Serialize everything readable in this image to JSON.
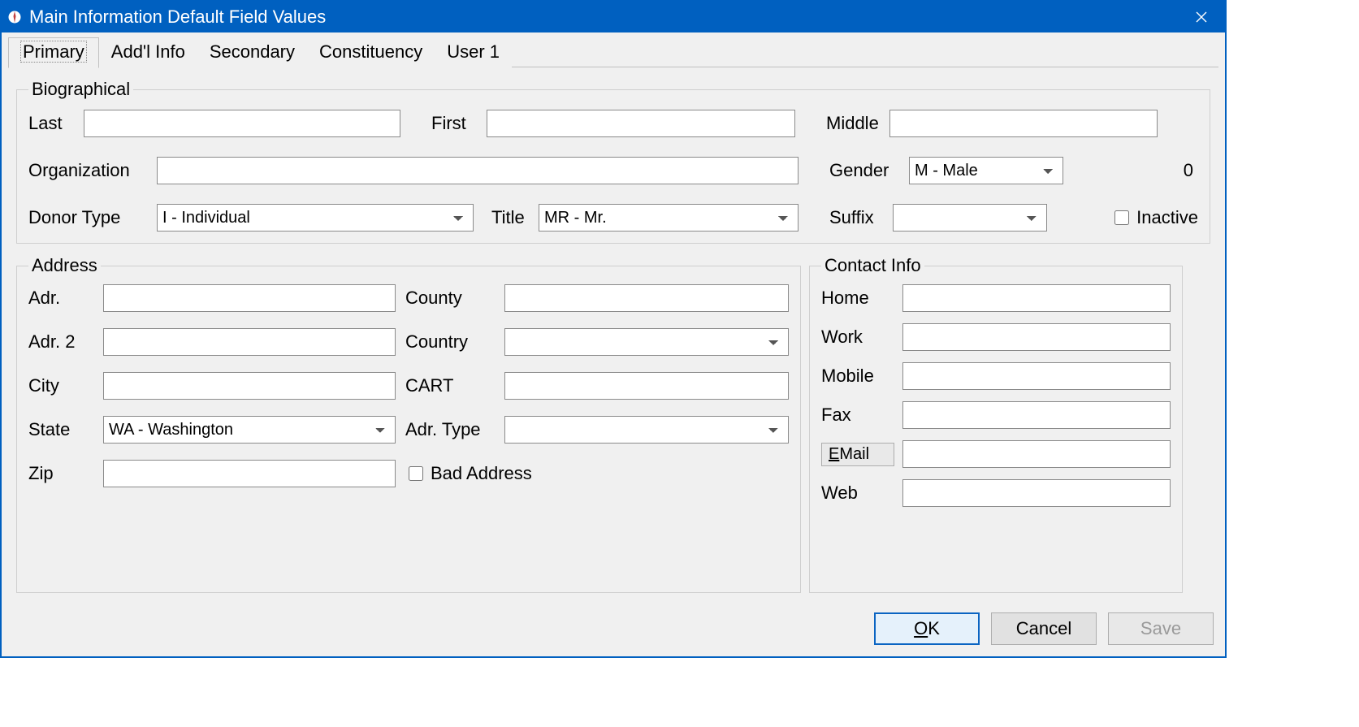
{
  "window": {
    "title": "Main Information Default Field Values"
  },
  "tabs": [
    {
      "label": "Primary"
    },
    {
      "label": "Add'l Info"
    },
    {
      "label": "Secondary"
    },
    {
      "label": "Constituency"
    },
    {
      "label": "User 1"
    }
  ],
  "biographical": {
    "legend": "Biographical",
    "labels": {
      "last": "Last",
      "first": "First",
      "middle": "Middle",
      "organization": "Organization",
      "gender": "Gender",
      "donor_type": "Donor Type",
      "title": "Title",
      "suffix": "Suffix",
      "inactive": "Inactive"
    },
    "values": {
      "last": "",
      "first": "",
      "middle": "",
      "organization": "",
      "gender": "M - Male",
      "donor_type": "I - Individual",
      "title": "MR - Mr.",
      "suffix": "",
      "inactive": false,
      "zero": "0"
    }
  },
  "address": {
    "legend": "Address",
    "labels": {
      "adr": "Adr.",
      "adr2": "Adr. 2",
      "city": "City",
      "state": "State",
      "zip": "Zip",
      "county": "County",
      "country": "Country",
      "cart": "CART",
      "adr_type": "Adr. Type",
      "bad_address": "Bad Address"
    },
    "values": {
      "adr": "",
      "adr2": "",
      "city": "",
      "state": "WA - Washington",
      "zip": "",
      "county": "",
      "country": "",
      "cart": "",
      "adr_type": "",
      "bad_address": false
    }
  },
  "contact": {
    "legend": "Contact Info",
    "labels": {
      "home": "Home",
      "work": "Work",
      "mobile": "Mobile",
      "fax": "Fax",
      "email_prefix": "E",
      "email_rest": "Mail",
      "web": "Web"
    },
    "values": {
      "home": "",
      "work": "",
      "mobile": "",
      "fax": "",
      "email": "",
      "web": ""
    }
  },
  "buttons": {
    "ok_prefix": "O",
    "ok_rest": "K",
    "cancel": "Cancel",
    "save": "Save"
  }
}
